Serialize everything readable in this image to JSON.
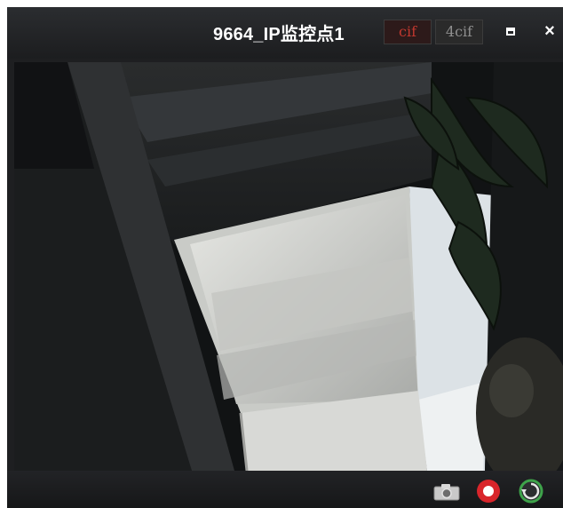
{
  "window": {
    "title": "9664_IP监控点1",
    "stream_options": [
      "cif",
      "4cif"
    ],
    "selected_stream": "cif"
  },
  "controls": {
    "maximize_icon": "maximize-icon",
    "close_icon": "×"
  },
  "toolbar": {
    "icons": [
      "camera-capture-icon",
      "record-icon",
      "refresh-icon"
    ]
  },
  "colors": {
    "title_text": "#ffffff",
    "stream_selected": "#c2382f",
    "stream_unselected": "#8f8f8f",
    "record_red": "#d9252b",
    "refresh_green": "#3ea34a"
  }
}
